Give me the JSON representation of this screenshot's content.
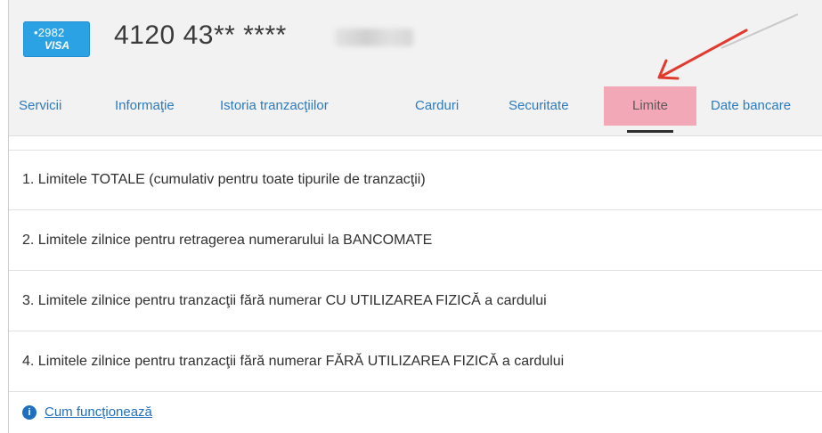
{
  "card": {
    "last4_label": "•2982",
    "brand": "VISA",
    "number": "4120 43** ****"
  },
  "tabs": [
    {
      "label": "Servicii"
    },
    {
      "label": "Informaţie"
    },
    {
      "label": "Istoria tranzacţiilor"
    },
    {
      "label": "Carduri"
    },
    {
      "label": "Securitate"
    },
    {
      "label": "Limite"
    },
    {
      "label": "Date bancare"
    }
  ],
  "limits": [
    {
      "label": "1. Limitele TOTALE (cumulativ pentru toate tipurile de tranzacţii)"
    },
    {
      "label": "2. Limitele zilnice pentru retragerea numerarului la BANCOMATE"
    },
    {
      "label": "3. Limitele zilnice pentru tranzacţii fără numerar CU UTILIZAREA FIZICĂ a cardului"
    },
    {
      "label": "4. Limitele zilnice pentru tranzacţii fără numerar FĂRĂ UTILIZAREA FIZICĂ a cardului"
    }
  ],
  "help": {
    "label": "Cum funcţionează",
    "icon": "info-icon"
  },
  "colors": {
    "accent": "#2b7bc1",
    "active_tab": "#f3a8b7",
    "annotation_arrow": "#e23b2e"
  }
}
